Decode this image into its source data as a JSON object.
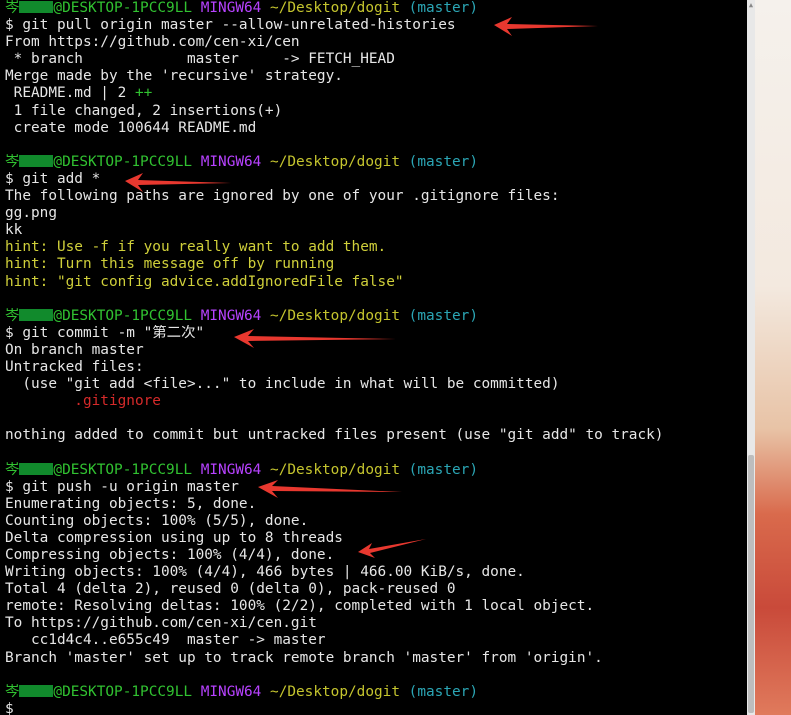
{
  "colors": {
    "background": "#000000",
    "text": "#e6e6e6",
    "user_host": "#31c231",
    "shell_name": "#b742ff",
    "path": "#c4c42e",
    "branch": "#2ba6b5",
    "hint": "#cfcf3a",
    "untracked_file": "#d62a2a",
    "annotation_arrow": "#e8382f"
  },
  "prompt": {
    "user_prefix": "岑",
    "host": "@DESKTOP-1PCC9LL",
    "shell": "MINGW64",
    "path": "~/Desktop/dogit",
    "branch": "(master)",
    "symbol": "$"
  },
  "terminal": {
    "cmd_pull": "$ git pull origin master --allow-unrelated-histories",
    "pull_from": "From https://github.com/cen-xi/cen",
    "pull_branch": " * branch            master     -> FETCH_HEAD",
    "pull_merge": "Merge made by the 'recursive' strategy.",
    "pull_stat_file": " README.md | 2 ",
    "pull_stat_plus": "++",
    "pull_summary": " 1 file changed, 2 insertions(+)",
    "pull_create": " create mode 100644 README.md",
    "cmd_add": "$ git add *",
    "add_ignored": "The following paths are ignored by one of your .gitignore files:",
    "add_file1": "gg.png",
    "add_file2": "kk",
    "hint1": "hint: Use -f if you really want to add them.",
    "hint2": "hint: Turn this message off by running",
    "hint3": "hint: \"git config advice.addIgnoredFile false\"",
    "cmd_commit": "$ git commit -m \"第二次\"",
    "commit_branch": "On branch master",
    "commit_untracked": "Untracked files:",
    "commit_use": "  (use \"git add <file>...\" to include in what will be committed)",
    "commit_gitignore": "        .gitignore",
    "commit_nothing": "nothing added to commit but untracked files present (use \"git add\" to track)",
    "cmd_push": "$ git push -u origin master",
    "push_enum": "Enumerating objects: 5, done.",
    "push_count": "Counting objects: 100% (5/5), done.",
    "push_delta": "Delta compression using up to 8 threads",
    "push_compress": "Compressing objects: 100% (4/4), done.",
    "push_write": "Writing objects: 100% (4/4), 466 bytes | 466.00 KiB/s, done.",
    "push_total": "Total 4 (delta 2), reused 0 (delta 0), pack-reused 0",
    "push_remote": "remote: Resolving deltas: 100% (2/2), completed with 1 local object.",
    "push_to": "To https://github.com/cen-xi/cen.git",
    "push_refs": "   cc1d4c4..e655c49  master -> master",
    "push_branch": "Branch 'master' set up to track remote branch 'master' from 'origin'."
  }
}
